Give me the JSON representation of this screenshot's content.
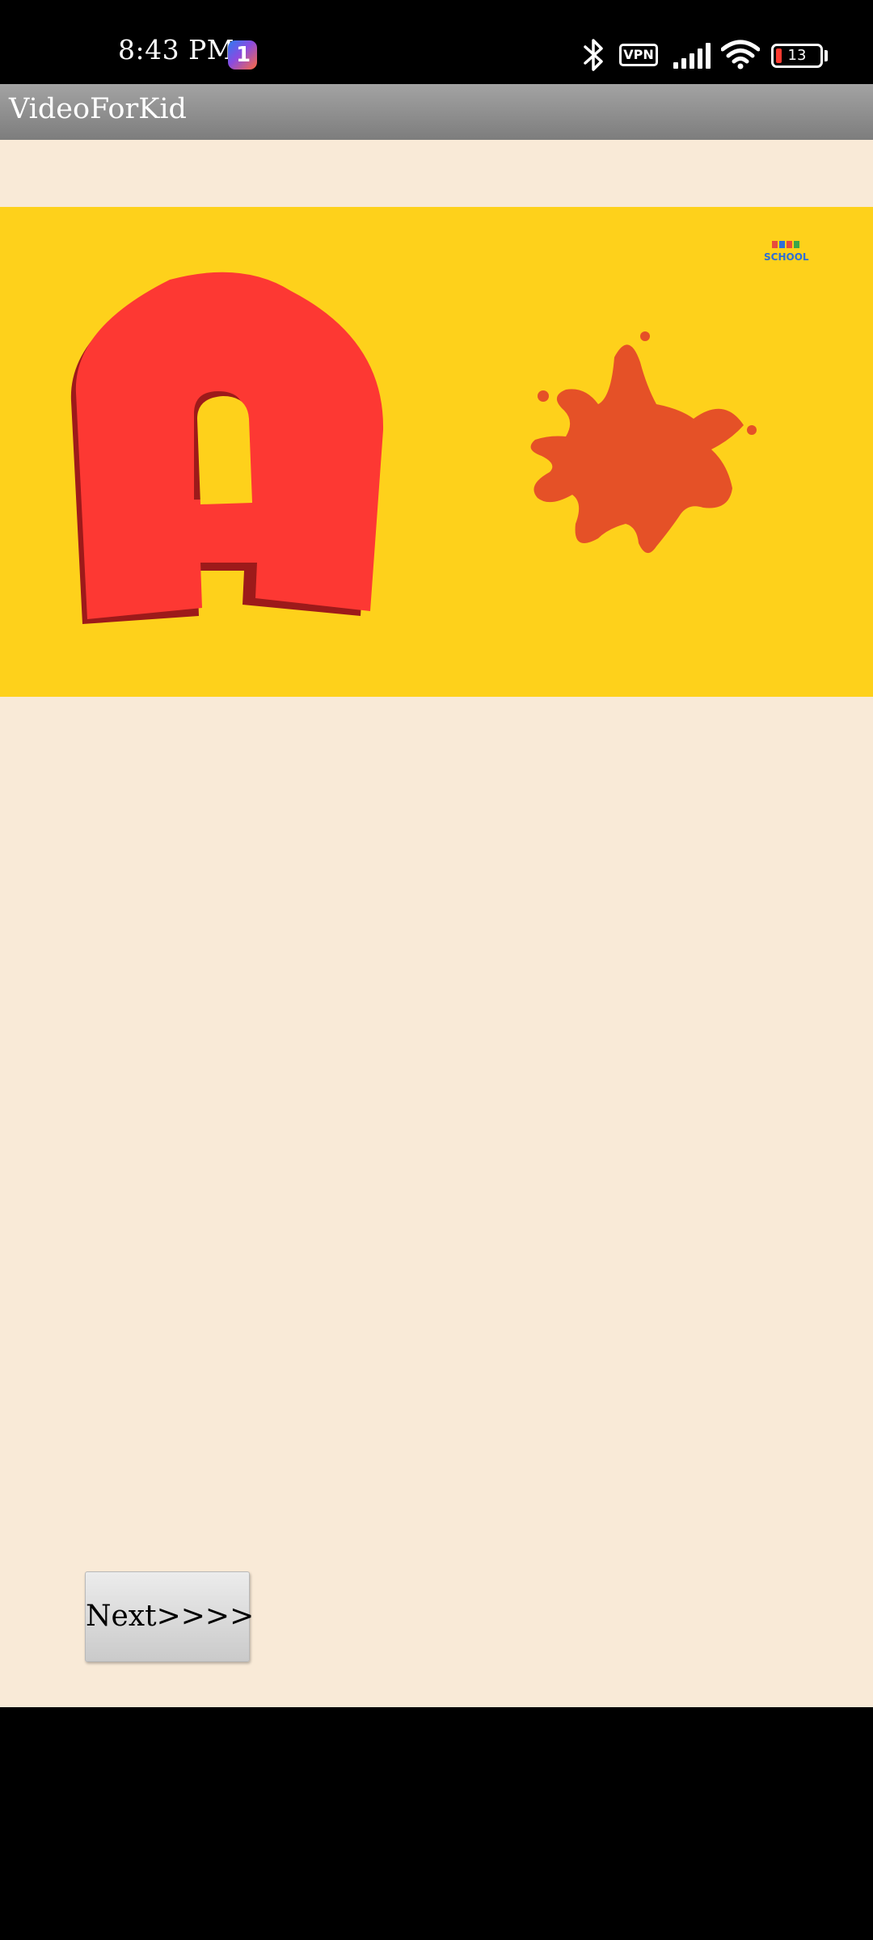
{
  "status_bar": {
    "time": "8:43 PM",
    "app_badge": "1",
    "vpn": "VPN",
    "battery": "13",
    "icons": [
      "bluetooth-icon",
      "vpn-icon",
      "signal-icon",
      "wifi-icon",
      "battery-icon"
    ]
  },
  "app_bar": {
    "title": "VideoForKid"
  },
  "video": {
    "letter": "A",
    "watermark": "SCHOOL",
    "colors": {
      "background": "#fed11b",
      "letter": "#fd3833",
      "splat": "#e55127"
    }
  },
  "next_button": {
    "label": "Next>>>>"
  },
  "colors": {
    "content_background": "#f9ead7",
    "app_bar": "#8f8f8f"
  }
}
